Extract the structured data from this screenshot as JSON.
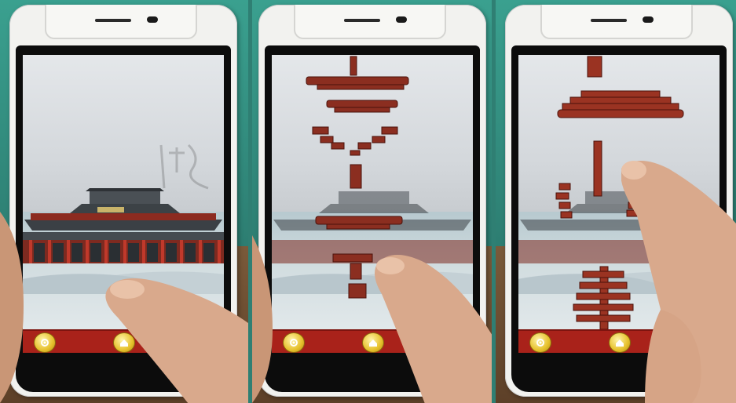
{
  "image": {
    "description_panels": 3,
    "panels": [
      {
        "id": "panel-1",
        "state": "assembled-hall"
      },
      {
        "id": "panel-2",
        "state": "exploded-bracket-sets"
      },
      {
        "id": "panel-3",
        "state": "exploded-dougong"
      }
    ]
  },
  "app_ui": {
    "bottom_bar_color": "#a9221a",
    "button_color": "#e6c12c",
    "buttons": [
      "settings-icon",
      "home-icon",
      "settings-icon"
    ]
  }
}
